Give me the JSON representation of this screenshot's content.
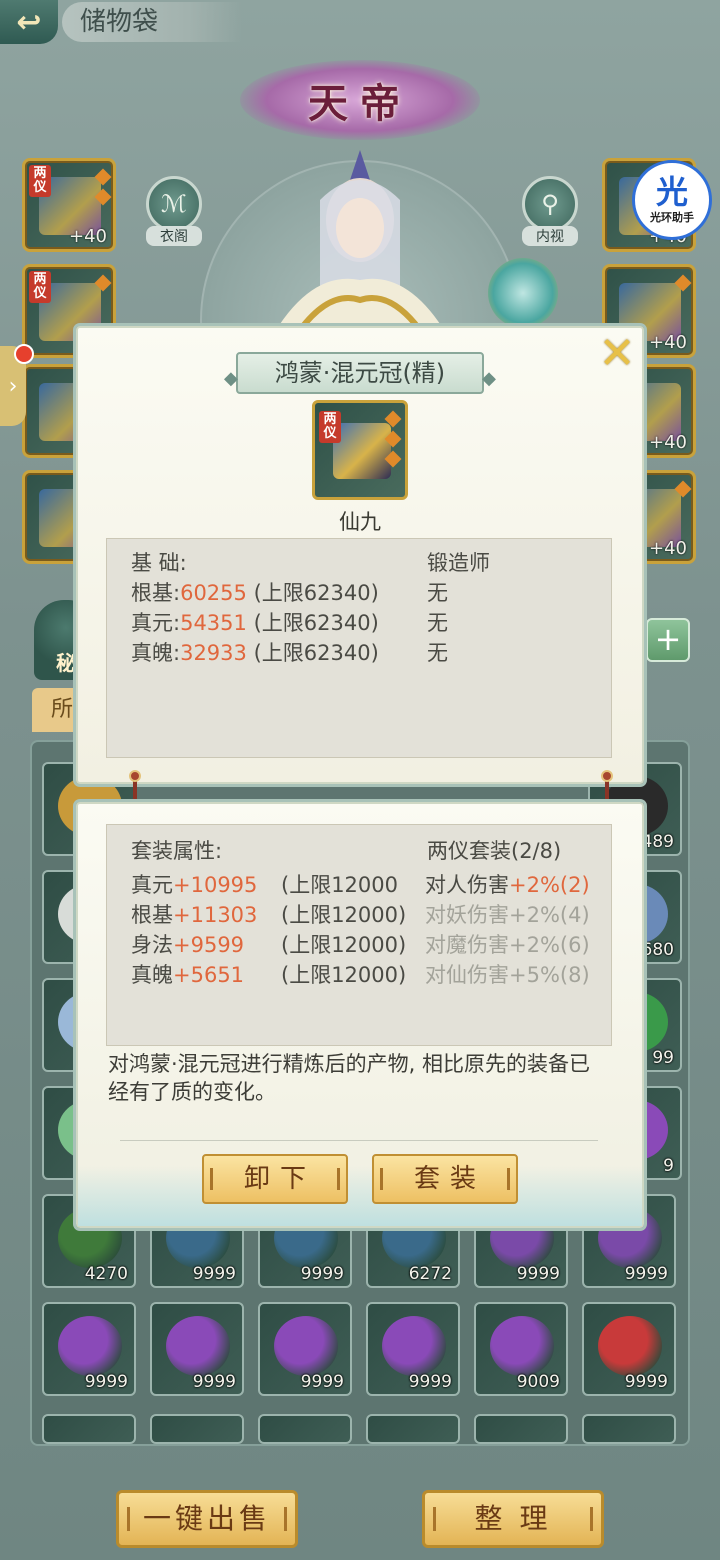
{
  "header": {
    "title": "储物袋",
    "back_icon": "back-arrow-icon"
  },
  "character": {
    "rank": "天帝",
    "buttons": [
      {
        "label": "衣阁",
        "icon": "robe-icon"
      },
      {
        "label": "内视",
        "icon": "magnifier-icon"
      }
    ]
  },
  "helper_badge": {
    "big": "光",
    "small": "光环助手"
  },
  "equipment": {
    "left": [
      {
        "tag": "两仪",
        "level": "+40"
      },
      {
        "tag": "两仪",
        "level": ""
      },
      {
        "tag": "",
        "level": ""
      },
      {
        "tag": "",
        "level": ""
      }
    ],
    "right": [
      {
        "level": "+40"
      },
      {
        "level": "+40"
      },
      {
        "level": "+40"
      },
      {
        "level": "+40"
      }
    ]
  },
  "bag": {
    "tab_secret": "秘",
    "tab_all": "所",
    "add_label": "+",
    "right_counts": [
      "489",
      "680",
      "99",
      "9"
    ],
    "rows": [
      [
        {
          "count": "4270",
          "color": "#3f7a3a"
        },
        {
          "count": "9999",
          "color": "#3a6a8a"
        },
        {
          "count": "9999",
          "color": "#3a6a8a"
        },
        {
          "count": "6272",
          "color": "#3a6a8a"
        },
        {
          "count": "9999",
          "color": "#7a4aa8"
        },
        {
          "count": "9999",
          "color": "#7a4aa8"
        }
      ],
      [
        {
          "count": "9999",
          "color": "#8a4ab8"
        },
        {
          "count": "9999",
          "color": "#8a4ab8"
        },
        {
          "count": "9999",
          "color": "#8a4ab8"
        },
        {
          "count": "9999",
          "color": "#8a4ab8"
        },
        {
          "count": "9009",
          "color": "#8a4ab8"
        },
        {
          "count": "9999",
          "color": "#c83a3a"
        }
      ]
    ]
  },
  "bottom_buttons": {
    "sell_all": "一键出售",
    "arrange": "整 理"
  },
  "item_dialog": {
    "name": "鸿蒙·混元冠(精)",
    "icon_tag": "两仪",
    "grade": "仙九",
    "close_icon": "close-x-icon",
    "base_header": "基 础:",
    "smith_header": "锻造师",
    "base_stats": [
      {
        "label": "根基:",
        "value": "60255",
        "cap": "(上限62340)",
        "smith": "无"
      },
      {
        "label": "真元:",
        "value": "54351",
        "cap": "(上限62340)",
        "smith": "无"
      },
      {
        "label": "真魄:",
        "value": "32933",
        "cap": "(上限62340)",
        "smith": "无"
      }
    ],
    "set_header": "套装属性:",
    "set_name": "两仪套装(2/8)",
    "set_stats": [
      {
        "label": "真元",
        "value": "+10995",
        "cap": "(上限12000",
        "bonus_label": "对人伤害",
        "bonus_value": "+2%(2)",
        "active": true
      },
      {
        "label": "根基",
        "value": "+11303",
        "cap": "(上限12000)",
        "bonus_label": "对妖伤害",
        "bonus_value": "+2%(4)",
        "active": false
      },
      {
        "label": "身法",
        "value": "+9599",
        "cap": "(上限12000)",
        "bonus_label": "对魔伤害",
        "bonus_value": "+2%(6)",
        "active": false
      },
      {
        "label": "真魄",
        "value": "+5651",
        "cap": "(上限12000)",
        "bonus_label": "对仙伤害",
        "bonus_value": "+5%(8)",
        "active": false
      }
    ],
    "description": "对鸿蒙·混元冠进行精炼后的产物, 相比原先的装备已经有了质的变化。",
    "unequip_label": "卸下",
    "set_label": "套装"
  }
}
